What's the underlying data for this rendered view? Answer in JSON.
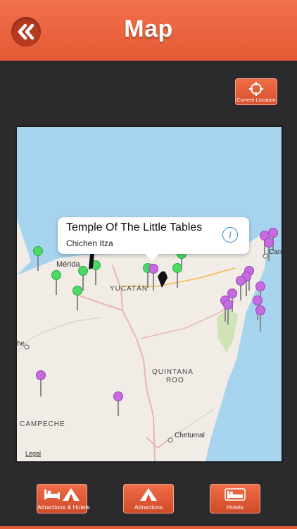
{
  "header": {
    "title": "Map",
    "back_icon": "double-chevron-left-icon"
  },
  "current_location": {
    "label": "Current Location",
    "icon": "crosshair-icon"
  },
  "map": {
    "labels": [
      "Mérida",
      "YUCATÁN",
      "QUINTANA",
      "ROO",
      "CAMPECHE",
      "Chetumal",
      "Can",
      "he"
    ],
    "legal": "Legal"
  },
  "callout": {
    "title": "Temple Of The Little Tables",
    "subtitle": "Chichen Itza",
    "icon": "info-icon"
  },
  "tabs": [
    {
      "label": "Attractions & Hotels",
      "icon": "bed-and-tent-icon"
    },
    {
      "label": "Attractions",
      "icon": "tent-icon"
    },
    {
      "label": "Hotels",
      "icon": "bed-icon"
    }
  ],
  "colors": {
    "accent": "#e45a35",
    "background": "#2b2a2d",
    "water": "#a6d3ee",
    "land": "#f1ede6",
    "pin_green": "#4cd964",
    "pin_purple": "#c66be0"
  }
}
